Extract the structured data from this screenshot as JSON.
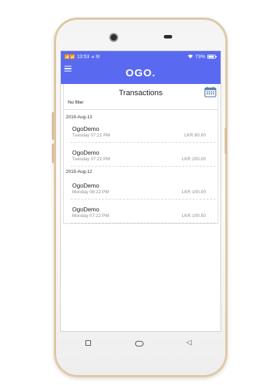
{
  "status": {
    "signal": "📶📶",
    "time": "13:53",
    "extra": "⚹ ✉",
    "battery": "73%"
  },
  "app": {
    "logo": "OGO."
  },
  "header": {
    "title": "Transactions",
    "filter": "No filter"
  },
  "groups": [
    {
      "date": "2019-Aug-13",
      "items": [
        {
          "name": "OgoDemo",
          "time": "Tuesday 07:22 PM",
          "amount": "LKR 80.00"
        },
        {
          "name": "OgoDemo",
          "time": "Tuesday 07:22 PM",
          "amount": "LKR 200.00"
        }
      ]
    },
    {
      "date": "2019-Aug-12",
      "items": [
        {
          "name": "OgoDemo",
          "time": "Monday 08:22 PM",
          "amount": "LKR 100.00"
        },
        {
          "name": "OgoDemo",
          "time": "Monday 07:22 PM",
          "amount": "LKR 100.50"
        }
      ]
    }
  ],
  "colors": {
    "primary": "#5a6af0",
    "frame": "#e2c9a6"
  }
}
